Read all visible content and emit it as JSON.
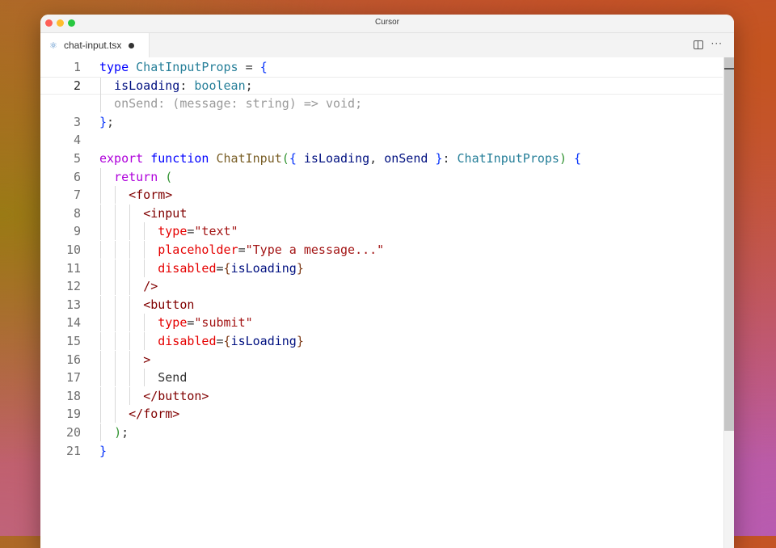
{
  "window": {
    "title": "Cursor"
  },
  "tab": {
    "filename": "chat-input.tsx",
    "icon": "react-icon",
    "modified": true
  },
  "toolbar": {
    "split_icon": "split-editor-icon",
    "more_icon": "more-actions-icon",
    "more_glyph": "···"
  },
  "editor": {
    "current_line": 2,
    "lines": [
      {
        "n": "1",
        "tokens": [
          [
            "kw",
            "type"
          ],
          [
            "plain",
            " "
          ],
          [
            "typ",
            "ChatInputProps"
          ],
          [
            "plain",
            " = "
          ],
          [
            "brace",
            "{"
          ]
        ]
      },
      {
        "n": "2",
        "tokens": [
          [
            "plain",
            "  "
          ],
          [
            "var",
            "isLoading"
          ],
          [
            "plain",
            ": "
          ],
          [
            "typ",
            "boolean"
          ],
          [
            "plain",
            ";"
          ]
        ]
      },
      {
        "n": "",
        "ghost": true,
        "tokens": [
          [
            "ghost",
            "  onSend: (message: string) => void;"
          ]
        ]
      },
      {
        "n": "3",
        "tokens": [
          [
            "brace",
            "}"
          ],
          [
            "plain",
            ";"
          ]
        ]
      },
      {
        "n": "4",
        "tokens": []
      },
      {
        "n": "5",
        "tokens": [
          [
            "kwc",
            "export"
          ],
          [
            "plain",
            " "
          ],
          [
            "kw",
            "function"
          ],
          [
            "plain",
            " "
          ],
          [
            "fn",
            "ChatInput"
          ],
          [
            "brace2",
            "("
          ],
          [
            "brace",
            "{"
          ],
          [
            "plain",
            " "
          ],
          [
            "var",
            "isLoading"
          ],
          [
            "plain",
            ", "
          ],
          [
            "var",
            "onSend"
          ],
          [
            "plain",
            " "
          ],
          [
            "brace",
            "}"
          ],
          [
            "plain",
            ": "
          ],
          [
            "typ",
            "ChatInputProps"
          ],
          [
            "brace2",
            ")"
          ],
          [
            "plain",
            " "
          ],
          [
            "brace",
            "{"
          ]
        ]
      },
      {
        "n": "6",
        "tokens": [
          [
            "plain",
            "  "
          ],
          [
            "kwc",
            "return"
          ],
          [
            "plain",
            " "
          ],
          [
            "brace2",
            "("
          ]
        ]
      },
      {
        "n": "7",
        "tokens": [
          [
            "plain",
            "    "
          ],
          [
            "tag",
            "<form>"
          ]
        ]
      },
      {
        "n": "8",
        "tokens": [
          [
            "plain",
            "      "
          ],
          [
            "tag",
            "<input"
          ]
        ]
      },
      {
        "n": "9",
        "tokens": [
          [
            "plain",
            "        "
          ],
          [
            "attr",
            "type"
          ],
          [
            "plain",
            "="
          ],
          [
            "str",
            "\"text\""
          ]
        ]
      },
      {
        "n": "10",
        "tokens": [
          [
            "plain",
            "        "
          ],
          [
            "attr",
            "placeholder"
          ],
          [
            "plain",
            "="
          ],
          [
            "str",
            "\"Type a message...\""
          ]
        ]
      },
      {
        "n": "11",
        "tokens": [
          [
            "plain",
            "        "
          ],
          [
            "attr",
            "disabled"
          ],
          [
            "plain",
            "="
          ],
          [
            "brace3",
            "{"
          ],
          [
            "var",
            "isLoading"
          ],
          [
            "brace3",
            "}"
          ]
        ]
      },
      {
        "n": "12",
        "tokens": [
          [
            "plain",
            "      "
          ],
          [
            "tag",
            "/>"
          ]
        ]
      },
      {
        "n": "13",
        "tokens": [
          [
            "plain",
            "      "
          ],
          [
            "tag",
            "<button"
          ]
        ]
      },
      {
        "n": "14",
        "tokens": [
          [
            "plain",
            "        "
          ],
          [
            "attr",
            "type"
          ],
          [
            "plain",
            "="
          ],
          [
            "str",
            "\"submit\""
          ]
        ]
      },
      {
        "n": "15",
        "tokens": [
          [
            "plain",
            "        "
          ],
          [
            "attr",
            "disabled"
          ],
          [
            "plain",
            "="
          ],
          [
            "brace3",
            "{"
          ],
          [
            "var",
            "isLoading"
          ],
          [
            "brace3",
            "}"
          ]
        ]
      },
      {
        "n": "16",
        "tokens": [
          [
            "plain",
            "      "
          ],
          [
            "tag",
            ">"
          ]
        ]
      },
      {
        "n": "17",
        "tokens": [
          [
            "plain",
            "        Send"
          ]
        ]
      },
      {
        "n": "18",
        "tokens": [
          [
            "plain",
            "      "
          ],
          [
            "tag",
            "</button>"
          ]
        ]
      },
      {
        "n": "19",
        "tokens": [
          [
            "plain",
            "    "
          ],
          [
            "tag",
            "</form>"
          ]
        ]
      },
      {
        "n": "20",
        "tokens": [
          [
            "plain",
            "  "
          ],
          [
            "brace2",
            ")"
          ],
          [
            "plain",
            ";"
          ]
        ]
      },
      {
        "n": "21",
        "tokens": [
          [
            "brace",
            "}"
          ]
        ]
      }
    ]
  }
}
